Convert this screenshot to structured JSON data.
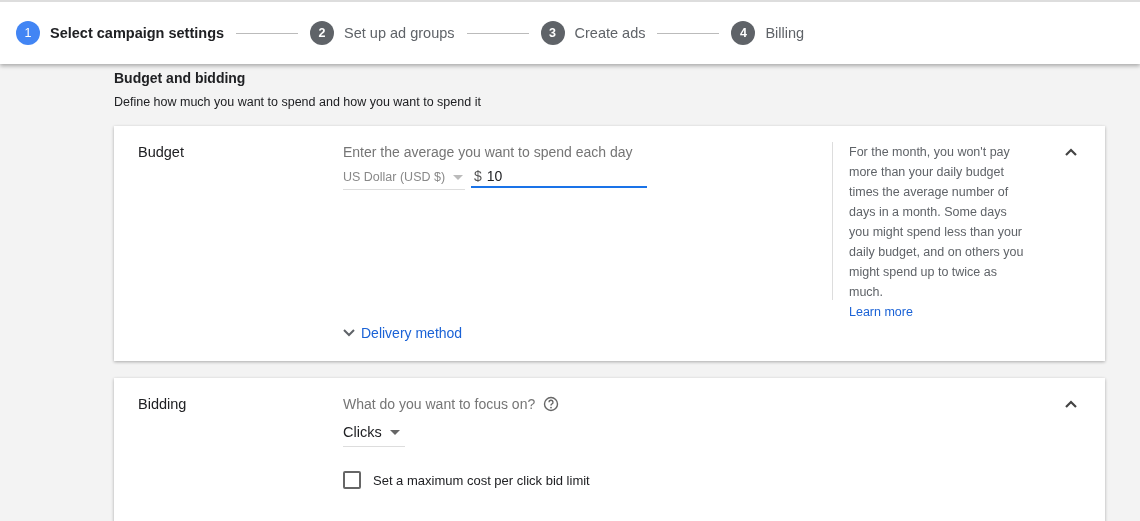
{
  "steps": [
    {
      "number": "1",
      "label": "Select campaign settings",
      "selected": true
    },
    {
      "number": "2",
      "label": "Set up ad groups",
      "selected": false
    },
    {
      "number": "3",
      "label": "Create ads",
      "selected": false
    },
    {
      "number": "4",
      "label": "Billing",
      "selected": false
    }
  ],
  "section": {
    "title": "Budget and bidding",
    "subtitle": "Define how much you want to spend and how you want to spend it"
  },
  "budget": {
    "title": "Budget",
    "prompt": "Enter the average you want to spend each day",
    "currency": "US Dollar (USD $)",
    "currency_symbol": "$",
    "amount": "10",
    "link": "Delivery method",
    "help": "For the month, you won't pay more than your daily budget times the average number of days in a month. Some days you might spend less than your daily budget, and on others you might spend up to twice as much.",
    "help_link": "Learn more",
    "expanded": true
  },
  "bidding": {
    "title": "Bidding",
    "prompt": "What do you want to focus on?",
    "focus": "Clicks",
    "checkbox_label": "Set a maximum cost per click bid limit",
    "checked": false,
    "expanded": true
  }
}
